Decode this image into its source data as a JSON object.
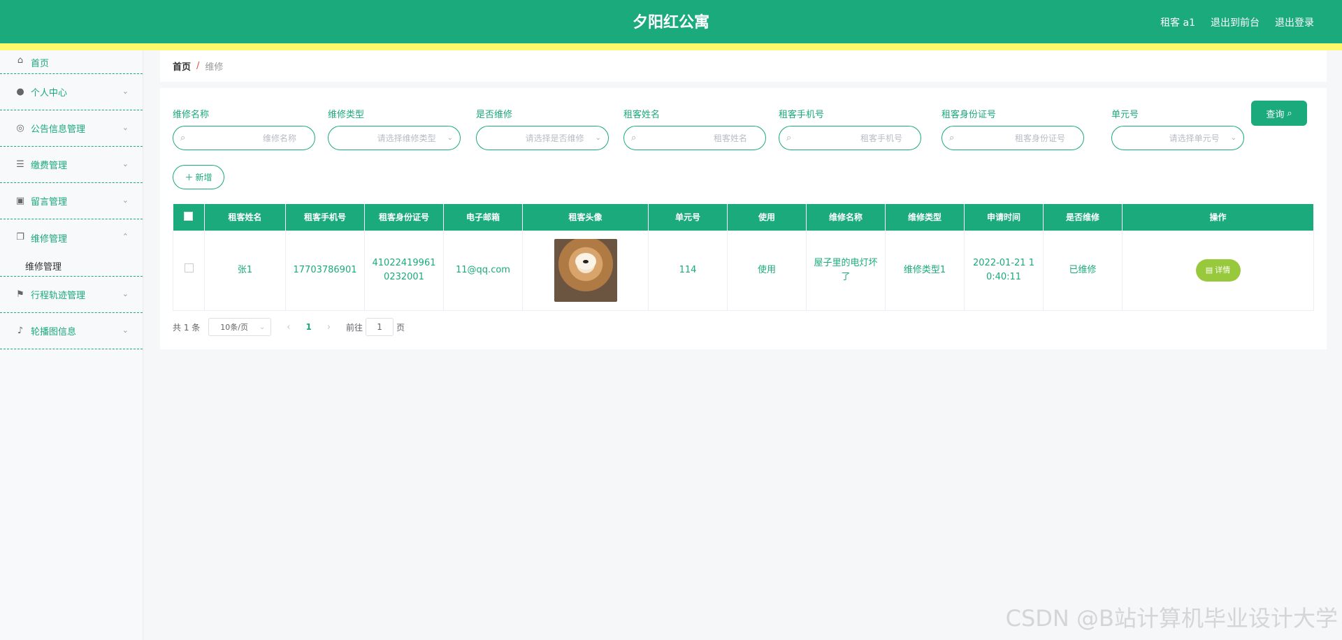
{
  "header": {
    "title": "夕阳红公寓",
    "user": "租客 a1",
    "to_frontend": "退出到前台",
    "logout": "退出登录"
  },
  "sidebar": {
    "items": [
      {
        "label": "首页",
        "icon": "home-icon"
      },
      {
        "label": "个人中心",
        "icon": "user-icon"
      },
      {
        "label": "公告信息管理",
        "icon": "notice-icon"
      },
      {
        "label": "缴费管理",
        "icon": "list-icon"
      },
      {
        "label": "留言管理",
        "icon": "clipboard-icon"
      },
      {
        "label": "维修管理",
        "icon": "copy-icon"
      },
      {
        "label": "行程轨迹管理",
        "icon": "flag-icon"
      },
      {
        "label": "轮播图信息",
        "icon": "microphone-icon"
      }
    ],
    "submenu": "维修管理"
  },
  "breadcrumb": {
    "home": "首页",
    "sep": "/",
    "current": "维修"
  },
  "filters": [
    {
      "label": "维修名称",
      "placeholder": "维修名称",
      "type": "input"
    },
    {
      "label": "维修类型",
      "placeholder": "请选择维修类型",
      "type": "select"
    },
    {
      "label": "是否维修",
      "placeholder": "请选择是否维修",
      "type": "select"
    },
    {
      "label": "租客姓名",
      "placeholder": "租客姓名",
      "type": "input"
    },
    {
      "label": "租客手机号",
      "placeholder": "租客手机号",
      "type": "input"
    },
    {
      "label": "租客身份证号",
      "placeholder": "租客身份证号",
      "type": "input"
    },
    {
      "label": "单元号",
      "placeholder": "请选择单元号",
      "type": "select"
    }
  ],
  "buttons": {
    "query": "查询",
    "add": "新增",
    "detail": "详情"
  },
  "table": {
    "headers": [
      "租客姓名",
      "租客手机号",
      "租客身份证号",
      "电子邮箱",
      "租客头像",
      "单元号",
      "使用",
      "维修名称",
      "维修类型",
      "申请时间",
      "是否维修",
      "操作"
    ],
    "rows": [
      {
        "name": "张1",
        "phone": "17703786901",
        "idcard": "410224199610232001",
        "email": "11@qq.com",
        "unit": "114",
        "use": "使用",
        "repair_name": "屋子里的电灯坏了",
        "repair_type": "维修类型1",
        "apply_time": "2022-01-21 10:40:11",
        "repaired": "已维修"
      }
    ]
  },
  "pager": {
    "total": "共 1 条",
    "page_size": "10条/页",
    "current": "1",
    "goto": "前往",
    "goto_value": "1",
    "page_unit": "页"
  },
  "watermark": "CSDN @B站计算机毕业设计大学",
  "colors": {
    "primary": "#1aaa7b",
    "stripe": "#fff86a",
    "detail": "#98c93c"
  }
}
